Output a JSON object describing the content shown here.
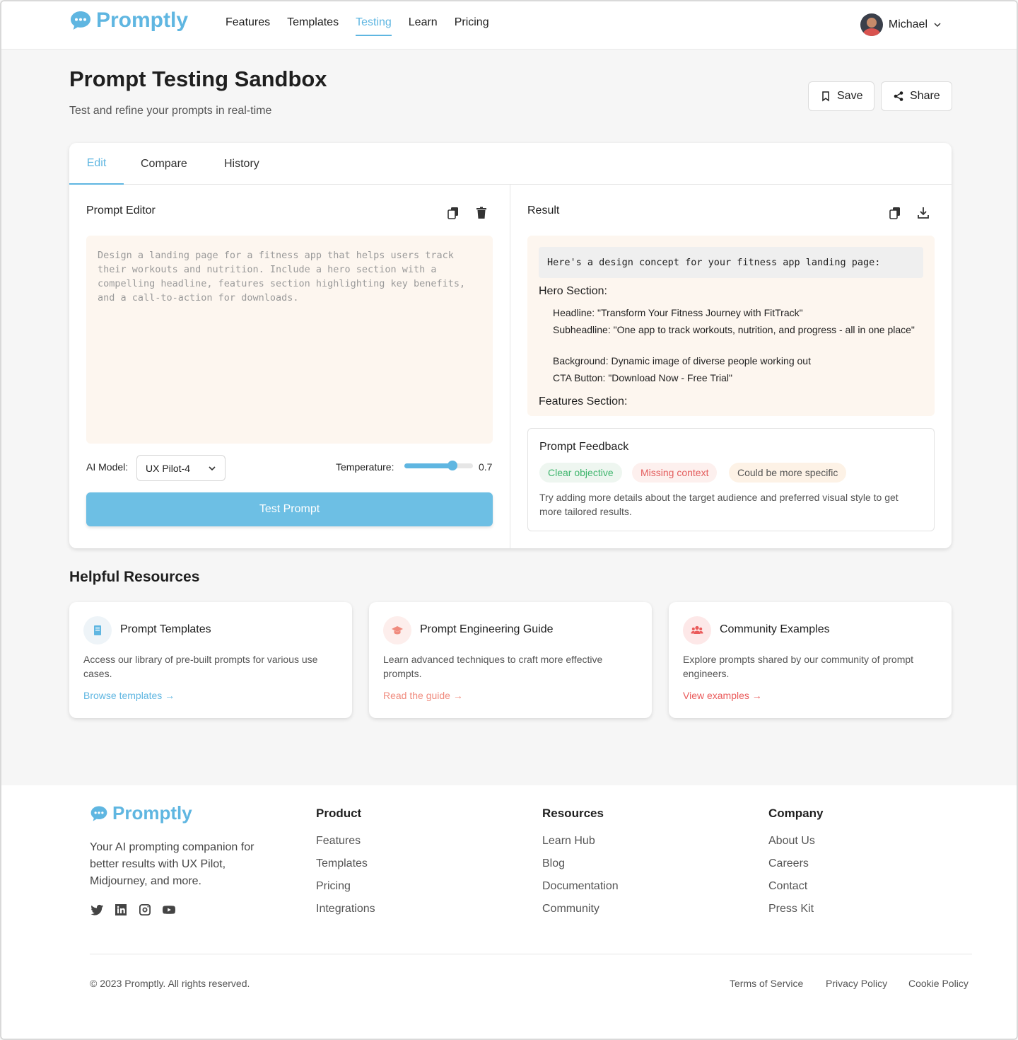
{
  "brand": {
    "name": "Promptly",
    "accent": "#5fb6e1"
  },
  "nav": {
    "items": [
      {
        "label": "Features"
      },
      {
        "label": "Templates"
      },
      {
        "label": "Testing",
        "active": true
      },
      {
        "label": "Learn"
      },
      {
        "label": "Pricing"
      }
    ]
  },
  "user": {
    "name": "Michael"
  },
  "page": {
    "title": "Prompt Testing Sandbox",
    "subtitle": "Test and refine your prompts in real-time",
    "save_label": "Save",
    "share_label": "Share"
  },
  "tabs": [
    {
      "label": "Edit",
      "active": true
    },
    {
      "label": "Compare"
    },
    {
      "label": "History"
    }
  ],
  "editor": {
    "title": "Prompt Editor",
    "placeholder": "Design a landing page for a fitness app that helps users track their workouts and nutrition. Include a hero section with a compelling headline, features section highlighting key benefits, and a call-to-action for downloads.",
    "model_label": "AI Model:",
    "model_value": "UX Pilot-4",
    "temperature_label": "Temperature:",
    "temperature_value": "0.7",
    "temperature_fraction": 0.7,
    "test_button": "Test Prompt"
  },
  "result": {
    "title": "Result",
    "intro": "Here's a design concept for your fitness app landing page:",
    "hero_heading": "Hero Section:",
    "hero_items": [
      "Headline: \"Transform Your Fitness Journey with FitTrack\"",
      "Subheadline: \"One app to track workouts, nutrition, and progress - all in one place\"",
      "Background: Dynamic image of diverse people working out",
      "CTA Button: \"Download Now - Free Trial\""
    ],
    "features_heading": "Features Section:"
  },
  "feedback": {
    "title": "Prompt Feedback",
    "chips": [
      {
        "label": "Clear objective",
        "color": "#3fb56d",
        "bg": "#eef6f0"
      },
      {
        "label": "Missing context",
        "color": "#e35d5d",
        "bg": "#fdf0ee"
      },
      {
        "label": "Could be more specific",
        "color": "#555555",
        "bg": "#fdf2e6"
      }
    ],
    "text": "Try adding more details about the target audience and preferred visual style to get more tailored results."
  },
  "resources": {
    "title": "Helpful Resources",
    "cards": [
      {
        "icon": "book-icon",
        "title": "Prompt Templates",
        "desc": "Access our library of pre-built prompts for various use cases.",
        "link": "Browse templates →",
        "color": "#5fb6e1"
      },
      {
        "icon": "graduation-cap-icon",
        "title": "Prompt Engineering Guide",
        "desc": "Learn advanced techniques to craft more effective prompts.",
        "link": "Read the guide →",
        "color": "#f08b7e"
      },
      {
        "icon": "users-icon",
        "title": "Community Examples",
        "desc": "Explore prompts shared by our community of prompt engineers.",
        "link": "View examples →",
        "color": "#ea5a5a"
      }
    ]
  },
  "footer": {
    "tagline": "Your AI prompting companion for better results with UX Pilot, Midjourney, and more.",
    "socials": [
      "twitter-icon",
      "linkedin-icon",
      "instagram-icon",
      "youtube-icon"
    ],
    "columns": [
      {
        "heading": "Product",
        "links": [
          "Features",
          "Templates",
          "Pricing",
          "Integrations"
        ]
      },
      {
        "heading": "Resources",
        "links": [
          "Learn Hub",
          "Blog",
          "Documentation",
          "Community"
        ]
      },
      {
        "heading": "Company",
        "links": [
          "About Us",
          "Careers",
          "Contact",
          "Press Kit"
        ]
      }
    ],
    "copyright": "© 2023 Promptly. All rights reserved.",
    "legal": [
      "Terms of Service",
      "Privacy Policy",
      "Cookie Policy"
    ]
  }
}
